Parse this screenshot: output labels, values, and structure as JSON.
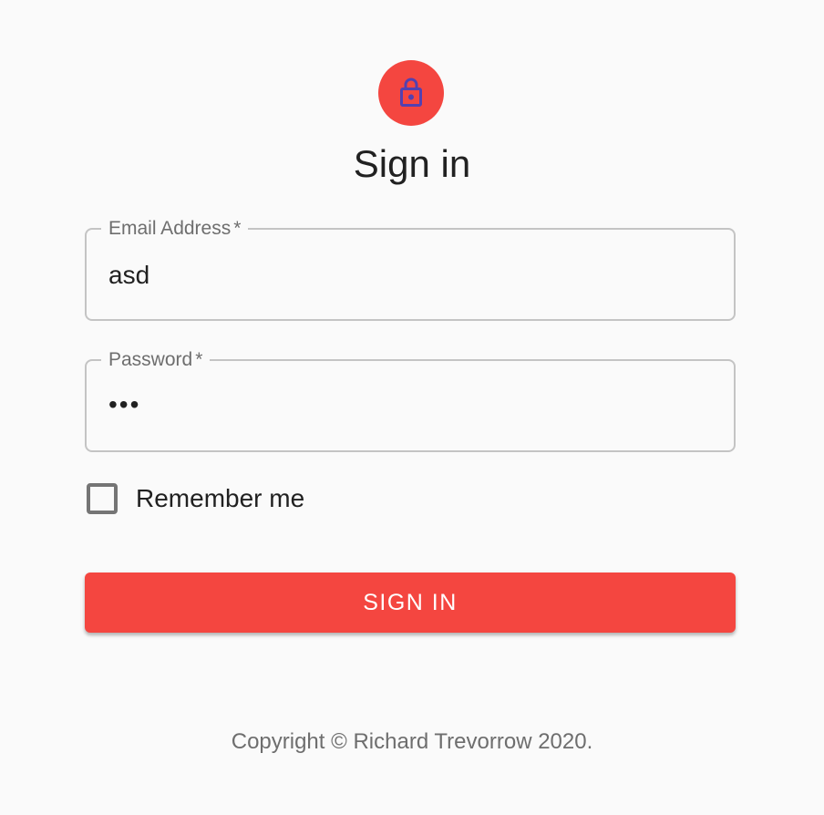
{
  "header": {
    "avatar_icon": "lock-outlined-icon",
    "title": "Sign in"
  },
  "form": {
    "email": {
      "label": "Email Address",
      "required_mark": "*",
      "value": "asd"
    },
    "password": {
      "label": "Password",
      "required_mark": "*",
      "masked_value": "•••"
    },
    "remember": {
      "label": "Remember me",
      "checked": false
    },
    "submit_label": "SIGN IN"
  },
  "footer": {
    "copyright": "Copyright © Richard Trevorrow 2020."
  },
  "colors": {
    "accent": "#f44640",
    "icon_color": "#5340b0",
    "background": "#fafafa",
    "border": "#c4c4c4",
    "muted_text": "#6e6e6e"
  }
}
